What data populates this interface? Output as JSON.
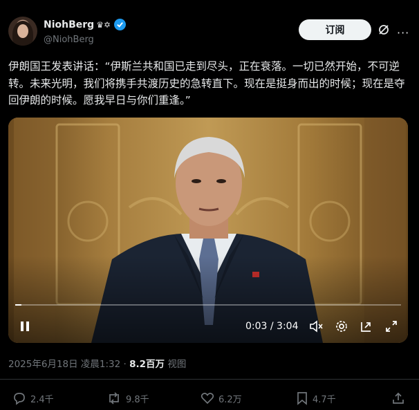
{
  "author": {
    "name": "NiohBerg",
    "name_suffix": "♛✡",
    "handle": "@NiohBerg"
  },
  "header": {
    "subscribe_label": "订阅"
  },
  "tweet": {
    "text": "伊朗国王发表讲话：“伊斯兰共和国已走到尽头，正在衰落。一切已然开始，不可逆转。未来光明，我们将携手共渡历史的急转直下。现在是挺身而出的时候；现在是夺回伊朗的时候。愿我早日与你们重逢。”"
  },
  "video": {
    "time": "0:03 / 3:04",
    "progress": 0.016
  },
  "meta": {
    "datetime": "2025年6月18日 凌晨1:32",
    "separator": "·",
    "views_count": "8.2百万",
    "views_label": "视图"
  },
  "actions": {
    "replies": "2.4千",
    "reposts": "9.8千",
    "likes": "6.2万",
    "bookmarks": "4.7千"
  },
  "colors": {
    "background": "#000000",
    "text": "#e7e9ea",
    "muted": "#71767b",
    "accent": "#1d9bf0",
    "button_bg": "#eff3f4"
  },
  "icons": [
    "verified-badge-icon",
    "grok-icon",
    "more-icon",
    "pause-icon",
    "volume-muted-icon",
    "settings-icon",
    "picture-in-picture-icon",
    "fullscreen-icon",
    "reply-icon",
    "repost-icon",
    "like-icon",
    "bookmark-icon",
    "share-icon"
  ]
}
